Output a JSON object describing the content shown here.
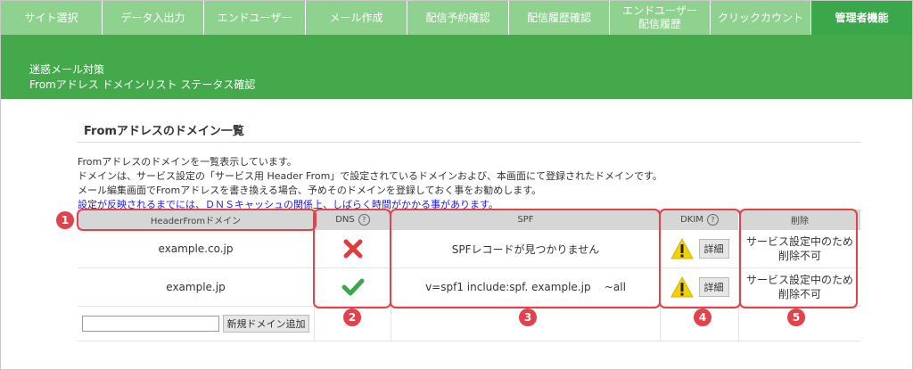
{
  "nav": {
    "items": [
      {
        "label": "サイト選択",
        "active": false
      },
      {
        "label": "データ入出力",
        "active": false
      },
      {
        "label": "エンドユーザー",
        "active": false
      },
      {
        "label": "メール作成",
        "active": false
      },
      {
        "label": "配信予約確認",
        "active": false
      },
      {
        "label": "配信履歴確認",
        "active": false
      },
      {
        "label": "エンドユーザー\n配信履歴",
        "active": false
      },
      {
        "label": "クリックカウント",
        "active": false
      },
      {
        "label": "管理者機能",
        "active": true
      }
    ]
  },
  "banner": {
    "line1": "迷惑メール対策",
    "line2": "Fromアドレス ドメインリスト ステータス確認"
  },
  "section": {
    "title": "Fromアドレスのドメイン一覧",
    "desc1": "Fromアドレスのドメインを一覧表示しています。",
    "desc2": "ドメインは、サービス設定の「サービス用 Header From」で設定されているドメインおよび、本画面にて登録されたドメインです。",
    "desc3": "メール編集画面でFromアドレスを書き換える場合、予めそのドメインを登録しておく事をお勧めします。",
    "notice": "設定が反映されるまでには、ＤＮＳキャッシュの関係上、しばらく時間がかかる事があります。"
  },
  "table": {
    "headers": {
      "domain": "HeaderFromドメイン",
      "dns": "DNS",
      "spf": "SPF",
      "dkim": "DKIM",
      "delete": "削除"
    },
    "help_glyph": "?",
    "rows": [
      {
        "domain": "example.co.jp",
        "dns_status": "fail",
        "spf": "SPFレコードが見つかりません",
        "dkim_status": "warning",
        "detail_label": "詳細",
        "delete_text": "サービス設定中のため\n削除不可"
      },
      {
        "domain": "example.jp",
        "dns_status": "ok",
        "spf": "v=spf1 include:spf. example.jp    ~all",
        "dkim_status": "warning",
        "detail_label": "詳細",
        "delete_text": "サービス設定中のため\n削除不可"
      }
    ],
    "new_domain_placeholder": "",
    "new_domain_button": "新規ドメイン追加"
  },
  "callouts": [
    "1",
    "2",
    "3",
    "4",
    "5"
  ],
  "colors": {
    "nav_bg": "#8fd18f",
    "nav_active": "#3aa84a",
    "banner_bg": "#43a94a",
    "callout": "#e3414b",
    "fail": "#e23b3b",
    "ok": "#3aa84a",
    "warning": "#f2d100",
    "notice_text": "#1a1aff"
  },
  "icons": {
    "dns_fail": "cross-icon",
    "dns_ok": "check-icon",
    "dkim_warning": "warning-icon",
    "help": "help-circle-icon"
  }
}
